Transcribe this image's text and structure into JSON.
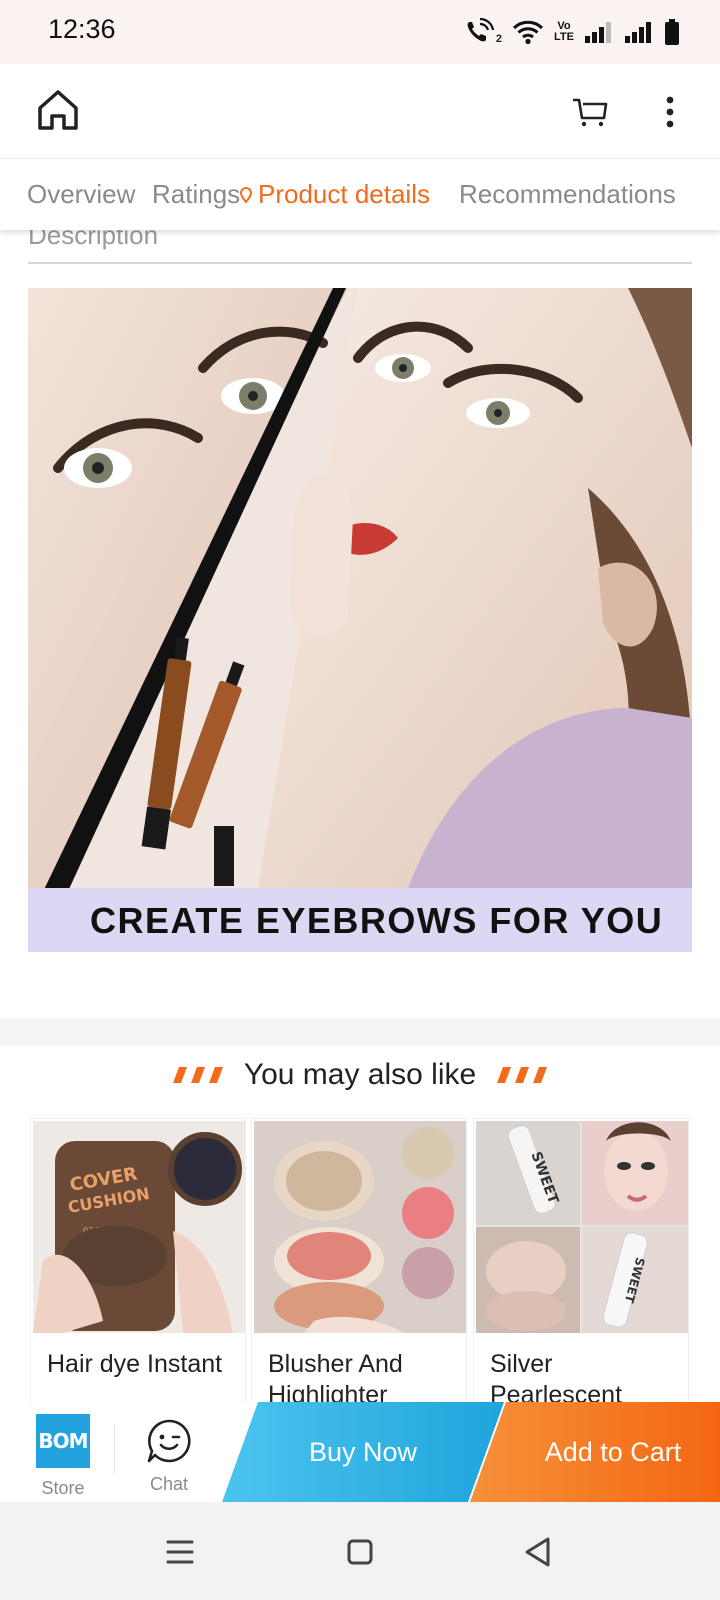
{
  "status_bar": {
    "time": "12:36",
    "icons": [
      "wifi-calling-icon",
      "wifi-icon",
      "volte-icon",
      "signal-icon",
      "signal-icon",
      "battery-icon"
    ],
    "volte_label_top": "Vo",
    "volte_label_bottom": "LTE",
    "calling_sim": "2"
  },
  "top_bar": {
    "icons": [
      "home-icon",
      "cart-icon",
      "more-vertical-icon"
    ]
  },
  "tabs": [
    {
      "label": "Overview",
      "active": false
    },
    {
      "label": "Ratings",
      "active": false
    },
    {
      "label": "Product details",
      "active": true
    },
    {
      "label": "Recommendations",
      "active": false
    }
  ],
  "accent_color": "#f26b1d",
  "description": {
    "title": "Description",
    "image_banner_text": "CREATE EYEBROWS FOR YOU"
  },
  "recommendations": {
    "title": "You may also like",
    "items": [
      {
        "name": "Hair dye Instant",
        "thumb_text_1": "COVER",
        "thumb_text_2": "CUSHION",
        "thumb_text_3": "03.NATURAL"
      },
      {
        "name": "Blusher And Highlighter"
      },
      {
        "name": "Silver Pearlescent",
        "thumb_text_1": "SWEET",
        "thumb_text_2": "SWEET"
      }
    ]
  },
  "action_bar": {
    "store_label": "Store",
    "store_logo_text": "BOM",
    "chat_label": "Chat",
    "buy_now_label": "Buy Now",
    "add_to_cart_label": "Add to Cart",
    "buy_color": "#1fa4dc",
    "cart_color": "#f46612"
  },
  "nav_bar": {
    "icons": [
      "menu-icon",
      "square-home-icon",
      "back-triangle-icon"
    ]
  }
}
